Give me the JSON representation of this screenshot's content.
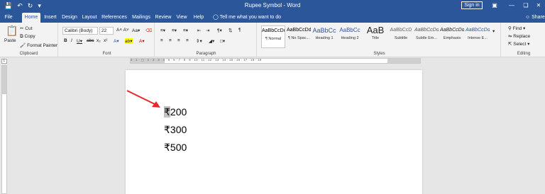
{
  "window": {
    "title": "Rupee Symbol - Word",
    "sign_in": "Sign in",
    "share": "Share"
  },
  "qat": {
    "save_icon": "save-icon",
    "undo_icon": "undo-icon",
    "redo_icon": "redo-icon",
    "customize_icon": "customize-icon"
  },
  "tabs": [
    "File",
    "Home",
    "Insert",
    "Design",
    "Layout",
    "References",
    "Mailings",
    "Review",
    "View",
    "Help"
  ],
  "tell_me": "Tell me what you want to do",
  "clipboard": {
    "paste": "Paste",
    "cut": "Cut",
    "copy": "Copy",
    "format_painter": "Format Painter",
    "label": "Clipboard"
  },
  "font": {
    "name": "Calibri (Body)",
    "size": "22",
    "label": "Font"
  },
  "paragraph": {
    "label": "Paragraph"
  },
  "styles": {
    "label": "Styles",
    "items": [
      {
        "sample": "AaBbCcDd",
        "name": "¶ Normal"
      },
      {
        "sample": "AaBbCcDd",
        "name": "¶ No Spac..."
      },
      {
        "sample": "AaBbCc",
        "name": "Heading 1"
      },
      {
        "sample": "AaBbCc",
        "name": "Heading 2"
      },
      {
        "sample": "AaB",
        "name": "Title"
      },
      {
        "sample": "AaBbCcD",
        "name": "Subtitle"
      },
      {
        "sample": "AaBbCcDd",
        "name": "Subtle Em..."
      },
      {
        "sample": "AaBbCcDd",
        "name": "Emphasis"
      },
      {
        "sample": "AaBbCcDd",
        "name": "Intense E..."
      }
    ]
  },
  "editing": {
    "find": "Find",
    "replace": "Replace",
    "select": "Select",
    "label": "Editing"
  },
  "ruler": {
    "numbers": "2 · 1 · ▢ · 1 · 2 · 3 · 4 · 5 · 6 · 7 · 8 · 9 · 10 · 11 · 12 · 13 · 14 · 15 · 16 · 17 · 18 · 19"
  },
  "document": {
    "lines": [
      {
        "symbol": "₹",
        "amount": "200"
      },
      {
        "symbol": "₹",
        "amount": "300"
      },
      {
        "symbol": "₹",
        "amount": "500"
      }
    ],
    "arrow_color": "#e8272c"
  },
  "colors": {
    "accent": "#2b579a",
    "ribbon_bg": "#f3f3f3"
  }
}
